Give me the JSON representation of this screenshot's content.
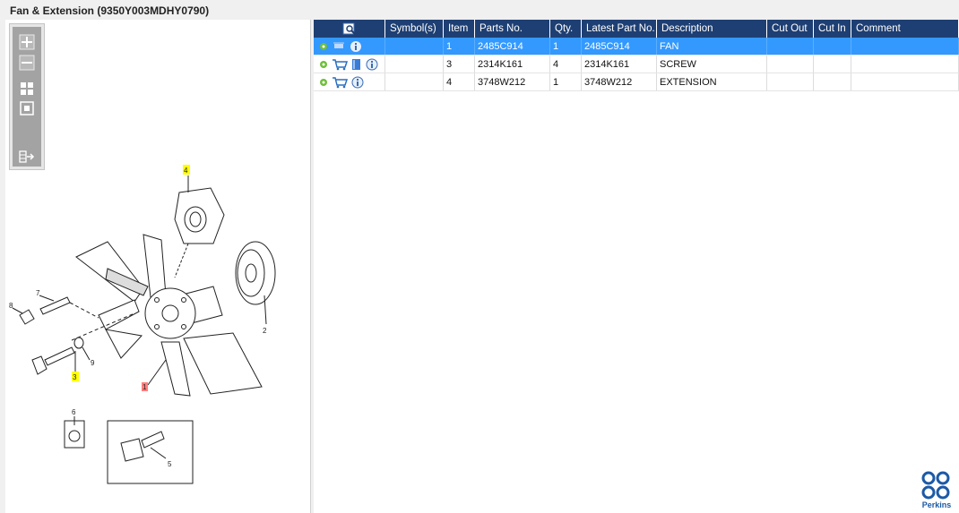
{
  "window": {
    "title": "Fan & Extension (9350Y003MDHY0790)"
  },
  "toolbar": {
    "zoom_in_icon": "plus-icon",
    "zoom_out_icon": "minus-icon",
    "fit_icon": "grid-icon",
    "actual_size_icon": "square-icon",
    "export_icon": "export-icon"
  },
  "diagram": {
    "callouts": [
      "1",
      "2",
      "3",
      "4",
      "5",
      "6",
      "7",
      "8",
      "9"
    ],
    "highlight_color": "#ffff00",
    "selected_color": "#ff7f7f"
  },
  "table": {
    "columns": [
      "Symbol(s)",
      "Item",
      "Parts No.",
      "Qty.",
      "Latest Part No.",
      "Description",
      "Cut Out",
      "Cut In",
      "Comment"
    ],
    "rows": [
      {
        "item": "1",
        "part_no": "2485C914",
        "qty": "1",
        "latest": "2485C914",
        "description": "FAN",
        "cut_out": "",
        "cut_in": "",
        "comment": ""
      },
      {
        "item": "3",
        "part_no": "2314K161",
        "qty": "4",
        "latest": "2314K161",
        "description": "SCREW",
        "cut_out": "",
        "cut_in": "",
        "comment": ""
      },
      {
        "item": "4",
        "part_no": "3748W212",
        "qty": "1",
        "latest": "3748W212",
        "description": "EXTENSION",
        "cut_out": "",
        "cut_in": "",
        "comment": ""
      }
    ]
  },
  "brand": {
    "name": "Perkins",
    "color": "#1c5aa6"
  },
  "colors": {
    "header": "#1e3f73",
    "selected_row": "#3399ff"
  }
}
